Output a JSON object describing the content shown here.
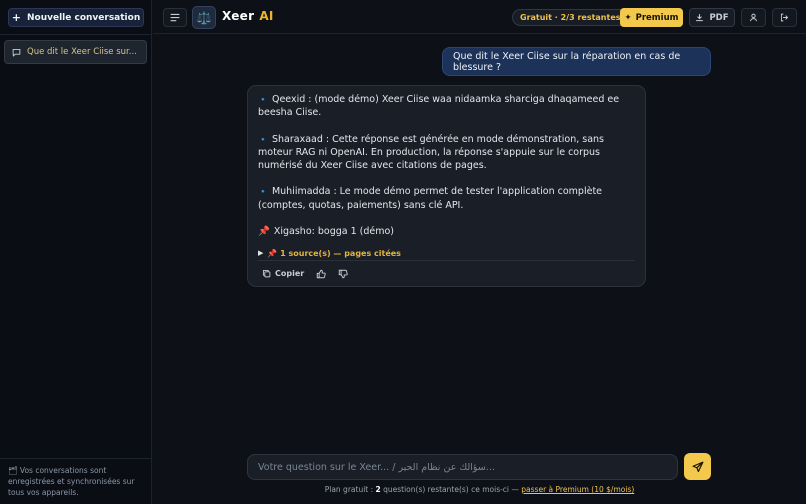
{
  "sidebar": {
    "new_conversation_label": "Nouvelle conversation",
    "conversations": [
      {
        "title": "Que dit le Xeer Ciise sur..."
      }
    ],
    "footer_text": "🗂 Vos conversations sont enregistrées et synchronisées sur tous vos appareils."
  },
  "header": {
    "brand_name": "Xeer",
    "brand_suffix": "AI",
    "logo_icon": "⚖️",
    "quota_badge": "Gratuit · 2/3 restantes",
    "premium_label": "Premium",
    "pdf_label": "PDF"
  },
  "chat": {
    "user_message": "Que dit le Xeer Ciise sur la réparation en cas de blessure ?",
    "bot_message": {
      "paragraphs": [
        {
          "icon": "🔹",
          "text": "Qeexid : (mode démo) Xeer Ciise waa nidaamka sharciga dhaqameed ee beesha Ciise."
        },
        {
          "icon": "🔹",
          "text": "Sharaxaad : Cette réponse est générée en mode démonstration, sans moteur RAG ni OpenAI. En production, la réponse s'appuie sur le corpus numérisé du Xeer Ciise avec citations de pages."
        },
        {
          "icon": "🔹",
          "text": "Muhiimadda : Le mode démo permet de tester l'application complète (comptes, quotas, paiements) sans clé API."
        },
        {
          "icon": "📌",
          "text": "Xigasho: bogga 1 (démo)"
        }
      ],
      "sources_toggle": "📌 1 source(s) — pages citées",
      "copy_label": "Copier"
    }
  },
  "composer": {
    "placeholder": "Votre question sur le Xeer... / سؤالك عن نظام الحير..."
  },
  "plan": {
    "prefix": "Plan gratuit : ",
    "count": "2",
    "suffix": " question(s) restante(s) ce mois-ci — ",
    "link": "passer à Premium (10 $/mois)"
  },
  "colors": {
    "accent": "#f2c94c",
    "user_bubble": "#1d3258",
    "background": "#0d1117"
  }
}
